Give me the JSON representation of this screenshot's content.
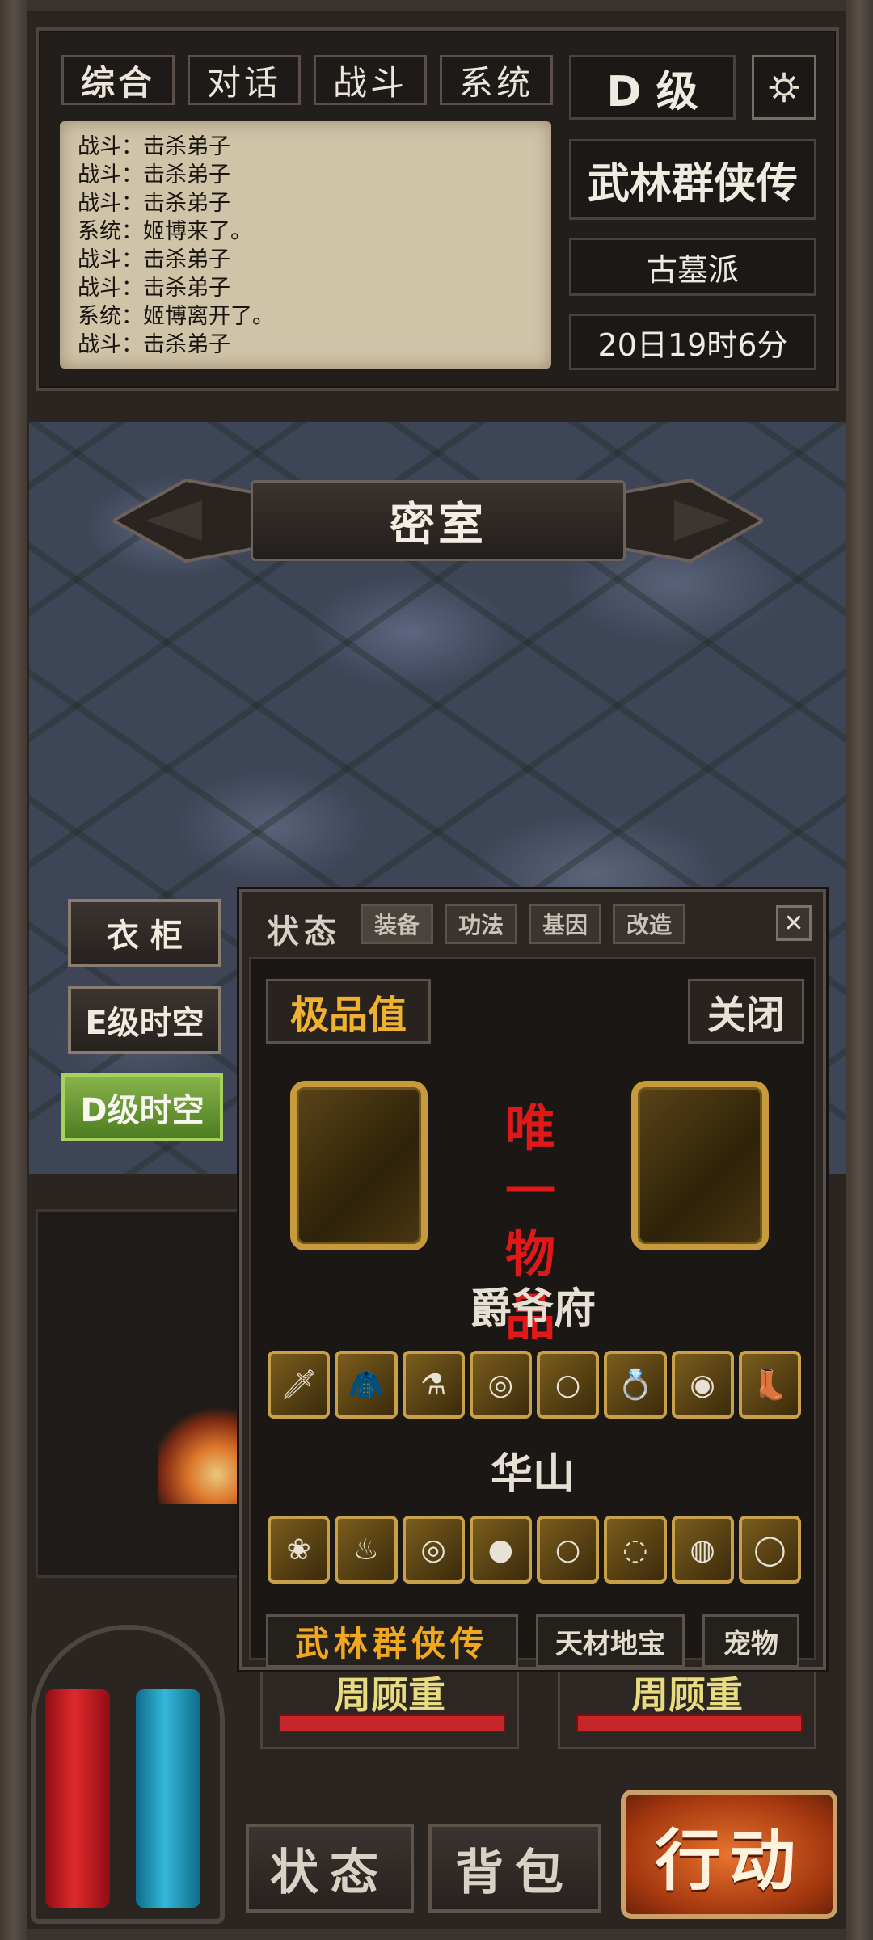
{
  "tabs": [
    "综合",
    "对话",
    "战斗",
    "系统"
  ],
  "log": [
    "战斗：击杀弟子",
    "战斗：击杀弟子",
    "战斗：击杀弟子",
    "系统：姬博来了。",
    "战斗：击杀弟子",
    "战斗：击杀弟子",
    "系统：姬博离开了。",
    "战斗：击杀弟子"
  ],
  "rank": "D 级",
  "game_title": "武林群侠传",
  "sect": "古墓派",
  "game_time": "20日19时6分",
  "location": "密室",
  "side_buttons": {
    "wardrobe": "衣 柜",
    "e_space": "E级时空",
    "d_space": "D级时空"
  },
  "enemy_cards": [
    {
      "name": "周顾重",
      "hp_fraction": 1.0
    },
    {
      "name": "周顾重",
      "hp_fraction": 1.0
    }
  ],
  "bottom": {
    "status": "状态",
    "bag": "背包",
    "action": "行动"
  },
  "dialog": {
    "title": "状态",
    "tabs": [
      "装备",
      "功法",
      "基因",
      "改造"
    ],
    "close_symbol": "✕",
    "quality_label": "极品值",
    "close_label": "关闭",
    "unique_text": "唯一物品",
    "sets": [
      {
        "title": "爵爷府",
        "items": [
          "sword",
          "cape",
          "potion",
          "bracelet",
          "ring",
          "ring",
          "amulet",
          "boots"
        ]
      },
      {
        "title": "华山",
        "items": [
          "herb",
          "robe",
          "bracelet",
          "orb",
          "ring",
          "bracelet",
          "pouch",
          "ring"
        ]
      }
    ],
    "categories": [
      "武林群侠传",
      "天材地宝",
      "宠物"
    ]
  },
  "colors": {
    "unique": "#e01818",
    "active_category": "#f1a81e",
    "quality": "#f0b030"
  }
}
